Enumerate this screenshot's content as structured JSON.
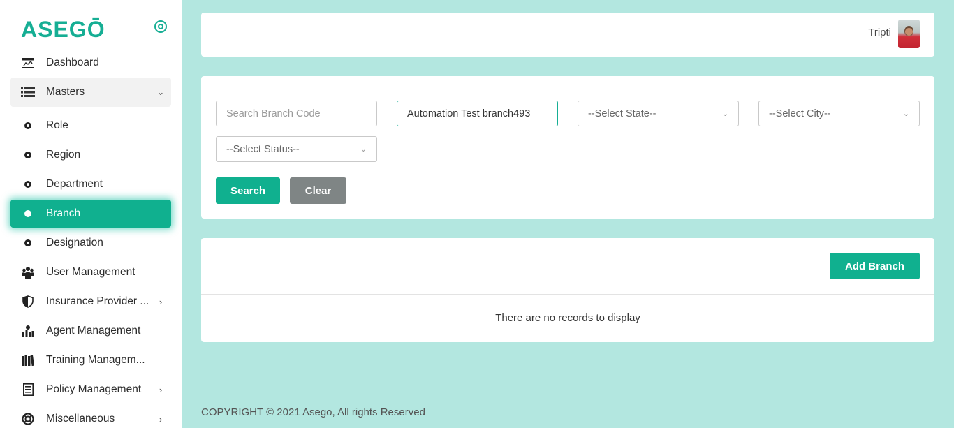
{
  "brand": {
    "logo_text": "ASEGŌ",
    "accent_color": "#10b08f"
  },
  "sidebar": {
    "items": [
      {
        "label": "Dashboard",
        "icon": "dashboard-icon"
      },
      {
        "label": "Masters",
        "icon": "list-icon",
        "expanded": true
      },
      {
        "label": "Role",
        "icon": "bullet-icon"
      },
      {
        "label": "Region",
        "icon": "bullet-icon"
      },
      {
        "label": "Department",
        "icon": "bullet-icon"
      },
      {
        "label": "Branch",
        "icon": "bullet-icon",
        "active": true
      },
      {
        "label": "Designation",
        "icon": "bullet-icon"
      },
      {
        "label": "User Management",
        "icon": "users-icon"
      },
      {
        "label": "Insurance Provider ...",
        "icon": "shield-icon"
      },
      {
        "label": "Agent Management",
        "icon": "agent-icon"
      },
      {
        "label": "Training Managem...",
        "icon": "books-icon"
      },
      {
        "label": "Policy Management",
        "icon": "document-icon"
      },
      {
        "label": "Miscellaneous",
        "icon": "lifebuoy-icon"
      }
    ]
  },
  "header": {
    "username": "Tripti"
  },
  "filters": {
    "branch_code_placeholder": "Search Branch Code",
    "branch_name_value": "Automation Test branch493",
    "state_select": "--Select State--",
    "city_select": "--Select City--",
    "status_select": "--Select Status--",
    "search_label": "Search",
    "clear_label": "Clear"
  },
  "list": {
    "add_label": "Add Branch",
    "empty_message": "There are no records to display"
  },
  "footer": {
    "copyright": "COPYRIGHT © 2021 Asego, All rights Reserved"
  }
}
